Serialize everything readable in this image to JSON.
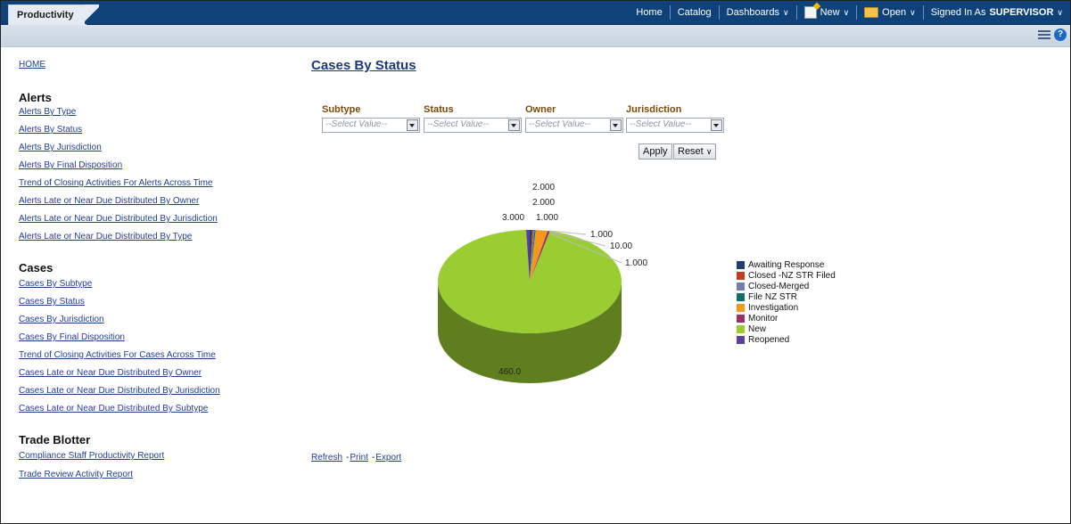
{
  "app": {
    "tab_label": "Productivity"
  },
  "global_nav": {
    "home": "Home",
    "catalog": "Catalog",
    "dashboards": "Dashboards",
    "new": "New",
    "open": "Open",
    "signed_in_prefix": "Signed In As",
    "user": "SUPERVISOR"
  },
  "sidebar": {
    "home": "HOME",
    "sections": [
      {
        "title": "Alerts",
        "links": [
          "Alerts By Type",
          "Alerts By Status",
          "Alerts By Jurisdiction",
          "Alerts By Final Disposition",
          "Trend of Closing Activities For Alerts Across Time",
          "Alerts Late or Near Due Distributed By Owner",
          "Alerts Late or Near Due Distributed By Jurisdiction",
          "Alerts Late or Near Due Distributed By Type"
        ]
      },
      {
        "title": "Cases",
        "links": [
          "Cases By Subtype",
          "Cases By Status",
          "Cases By Jurisdiction",
          "Cases By Final Disposition",
          "Trend of Closing Activities For Cases Across Time",
          "Cases Late or Near Due Distributed By Owner",
          "Cases Late or Near Due Distributed By Jurisdiction",
          "Cases Late or Near Due Distributed By Subtype"
        ]
      },
      {
        "title": "Trade Blotter",
        "links": [
          "Compliance Staff Productivity Report",
          "Trade Review Activity Report"
        ]
      }
    ]
  },
  "report": {
    "title": "Cases By Status",
    "prompts": [
      {
        "label": "Subtype",
        "placeholder": "--Select Value--"
      },
      {
        "label": "Status",
        "placeholder": "--Select Value--"
      },
      {
        "label": "Owner",
        "placeholder": "--Select Value--"
      },
      {
        "label": "Jurisdiction",
        "placeholder": "--Select Value--"
      }
    ],
    "apply_label": "Apply",
    "reset_label": "Reset",
    "actions": {
      "refresh": "Refresh",
      "print": "Print",
      "export": "Export"
    }
  },
  "chart_data": {
    "type": "pie",
    "title": "",
    "slices": [
      {
        "label": "Awaiting Response",
        "value": 2,
        "value_label": "2.000",
        "color": "#1f3f70"
      },
      {
        "label": "Closed -NZ STR Filed",
        "value": 1,
        "value_label": "1.000",
        "color": "#c23b22"
      },
      {
        "label": "Closed-Merged",
        "value": 1,
        "value_label": "1.000",
        "color": "#6f7fb0"
      },
      {
        "label": "File NZ STR",
        "value": 1,
        "value_label": "1.000",
        "color": "#146c6c"
      },
      {
        "label": "Investigation",
        "value": 10,
        "value_label": "10.00",
        "color": "#f39a1e"
      },
      {
        "label": "Monitor",
        "value": 2,
        "value_label": "2.000",
        "color": "#9c2e6a"
      },
      {
        "label": "New",
        "value": 460,
        "value_label": "460.0",
        "color": "#9acd32"
      },
      {
        "label": "Reopened",
        "value": 3,
        "value_label": "3.000",
        "color": "#5b3f99"
      }
    ],
    "legend_position": "right",
    "three_d": true
  }
}
